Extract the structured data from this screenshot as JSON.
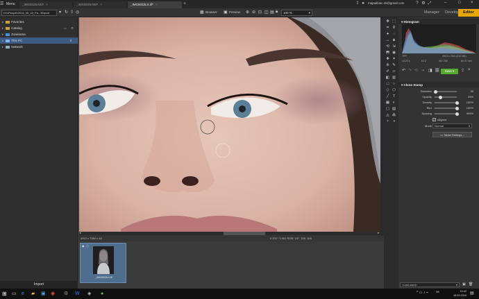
{
  "title_bar": {
    "menu": "Menu",
    "tabs": [
      {
        "label": "_IMG5028.NEF",
        "active": false
      },
      {
        "label": "_IMG5028.NEF",
        "active": false
      },
      {
        "label": "_IMG5032LX.tif*",
        "active": true
      }
    ],
    "user": "majaalbiac.sk@gmail.com"
  },
  "mode_bar": {
    "path": "H:\\vPeople\\2014_05_22_Pa...\\Export",
    "browser": "Browser",
    "preview": "Preview",
    "zoom": "100 %",
    "modes": [
      "Manager",
      "Develop",
      "Editor"
    ]
  },
  "navigator": {
    "items": [
      {
        "label": "Favorites",
        "selected": false
      },
      {
        "label": "Catalog",
        "selected": false
      },
      {
        "label": "Zonerama",
        "selected": false
      },
      {
        "label": "This PC",
        "selected": true
      },
      {
        "label": "Network",
        "selected": false
      }
    ],
    "import": "Import"
  },
  "status": {
    "left": "4913 x 7360 x 48",
    "right": "0 200 / 3 961   RGB: 187, 158, 166"
  },
  "filmstrip": {
    "items": [
      {
        "label": "_IMG5032LX.tif"
      }
    ]
  },
  "histogram": {
    "title": "Histogram",
    "info_left": "TIFF",
    "info_right": "4913 x 7360 (234 MB)",
    "row2": [
      "1/125 s",
      "f/2.2",
      "ISO 200",
      "85.00 mm"
    ],
    "save": "Save"
  },
  "clone_stamp": {
    "title": "Clone Stamp",
    "rows": [
      {
        "label": "Diameter",
        "value": "30",
        "fraction": 0.06
      },
      {
        "label": "Opacity",
        "value": "25%",
        "fraction": 0.25
      },
      {
        "label": "Density",
        "value": "100%",
        "fraction": 1.0
      },
      {
        "label": "Blur",
        "value": "100%",
        "fraction": 1.0
      },
      {
        "label": "Spacing",
        "value": "999%",
        "fraction": 1.0
      }
    ],
    "aligned": "Aligned",
    "mode_label": "Mode",
    "mode_value": "Normal",
    "tablet": "Tablet Settings..."
  },
  "panel_footer": {
    "search": "<Last used>"
  },
  "taskbar": {
    "time": "10:42",
    "date": "18.03.2016",
    "lang": "SK"
  },
  "colors": {
    "accent": "#e7a600",
    "selection": "#3d5a80",
    "save": "#5aa832"
  }
}
